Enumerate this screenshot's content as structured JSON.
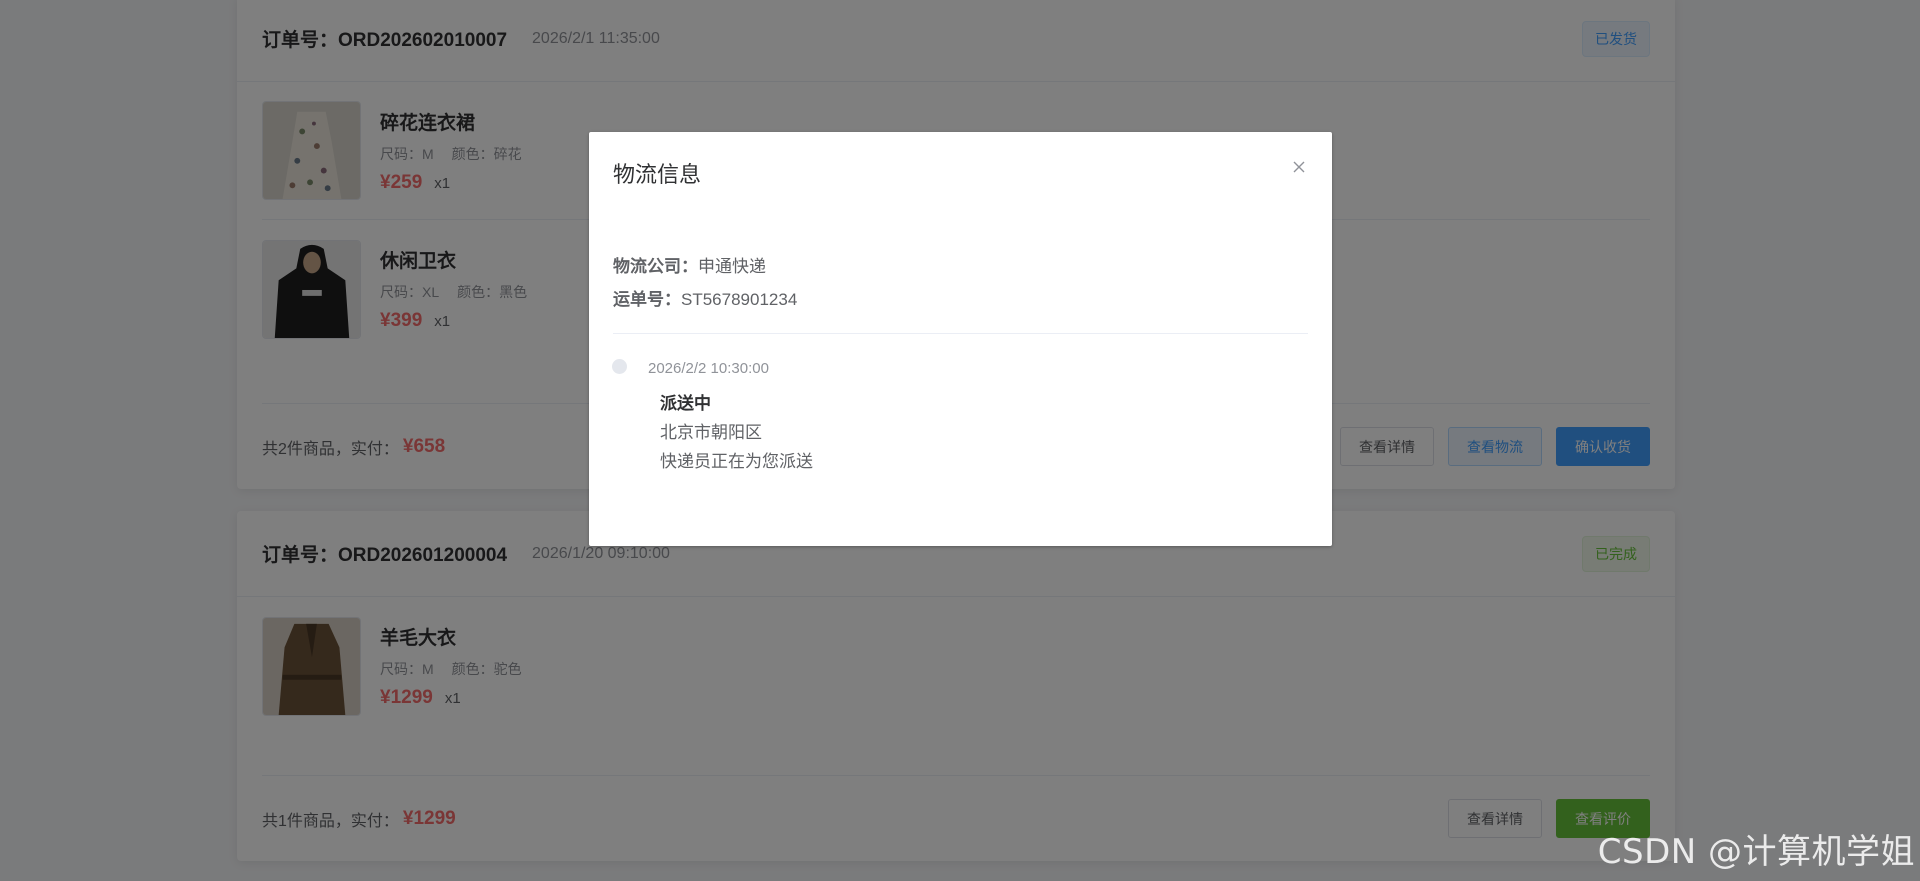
{
  "orders": [
    {
      "order_no": "订单号：ORD202602010007",
      "time": "2026/2/1 11:35:00",
      "status": "已发货",
      "items": [
        {
          "name": "碎花连衣裙",
          "size": "尺码：M",
          "color": "颜色：碎花",
          "price": "¥259",
          "qty": "x1"
        },
        {
          "name": "休闲卫衣",
          "size": "尺码：XL",
          "color": "颜色：黑色",
          "price": "¥399",
          "qty": "x1"
        }
      ],
      "total_text": "共2件商品，实付：",
      "total_amount": "¥658",
      "actions": [
        "查看详情",
        "查看物流",
        "确认收货"
      ]
    },
    {
      "order_no": "订单号：ORD202601200004",
      "time": "2026/1/20 09:10:00",
      "status": "已完成",
      "items": [
        {
          "name": "羊毛大衣",
          "size": "尺码：M",
          "color": "颜色：驼色",
          "price": "¥1299",
          "qty": "x1"
        }
      ],
      "total_text": "共1件商品，实付：",
      "total_amount": "¥1299",
      "actions": [
        "查看详情",
        "查看评价"
      ]
    }
  ],
  "dialog": {
    "title": "物流信息",
    "close_icon": "close-icon",
    "company_label": "物流公司：",
    "company_value": "申通快递",
    "tracking_label": "运单号：",
    "tracking_value": "ST5678901234",
    "timeline": [
      {
        "time": "2026/2/2 10:30:00",
        "status": "派送中",
        "location": "北京市朝阳区",
        "desc": "快递员正在为您派送"
      }
    ]
  },
  "watermark": "CSDN @计算机学姐",
  "colors": {
    "price": "#f56c6c",
    "primary": "#409eff",
    "success": "#67c23a"
  }
}
